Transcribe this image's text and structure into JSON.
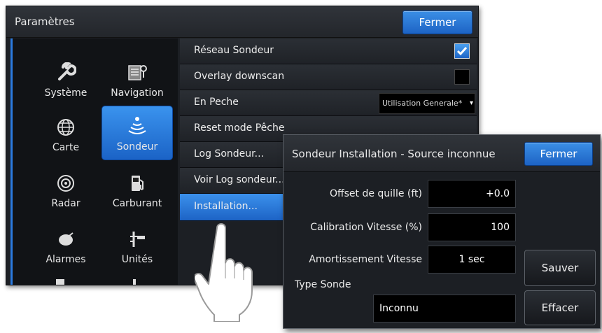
{
  "main": {
    "title": "Paramètres",
    "close_label": "Fermer",
    "categories": [
      {
        "label": "Système",
        "icon": "wrench-icon"
      },
      {
        "label": "Navigation",
        "icon": "navigation-icon"
      },
      {
        "label": "Carte",
        "icon": "globe-icon"
      },
      {
        "label": "Sondeur",
        "icon": "sonar-icon",
        "selected": true
      },
      {
        "label": "Radar",
        "icon": "radar-icon"
      },
      {
        "label": "Carburant",
        "icon": "fuel-pump-icon"
      },
      {
        "label": "Alarmes",
        "icon": "alarm-icon"
      },
      {
        "label": "Unités",
        "icon": "units-icon"
      }
    ],
    "rows": {
      "reseau_sondeur": {
        "label": "Réseau Sondeur",
        "checked": true
      },
      "overlay_downscan": {
        "label": "Overlay downscan",
        "checked": false
      },
      "en_peche": {
        "label": "En Peche",
        "value": "Utilisation Generale*"
      },
      "reset_mode_peche": {
        "label": "Reset mode Pêche"
      },
      "log_sondeur": {
        "label": "Log Sondeur..."
      },
      "voir_log": {
        "label": "Voir Log sondeur..."
      },
      "installation": {
        "label": "Installation...",
        "selected": true
      }
    }
  },
  "dialog": {
    "title": "Sondeur Installation - Source inconnue",
    "close_label": "Fermer",
    "fields": {
      "offset": {
        "label": "Offset de quille (ft)",
        "value": "+0.0"
      },
      "calibration": {
        "label": "Calibration Vitesse (%)",
        "value": "100"
      },
      "amortissement": {
        "label": "Amortissement Vitesse",
        "value": "1 sec"
      }
    },
    "type_sonde": {
      "label": "Type Sonde",
      "value": "Inconnu"
    },
    "save_label": "Sauver",
    "clear_label": "Effacer"
  },
  "colors": {
    "accent": "#2b7be0",
    "selection": "#1d63c6",
    "background": "#1c1f24"
  }
}
